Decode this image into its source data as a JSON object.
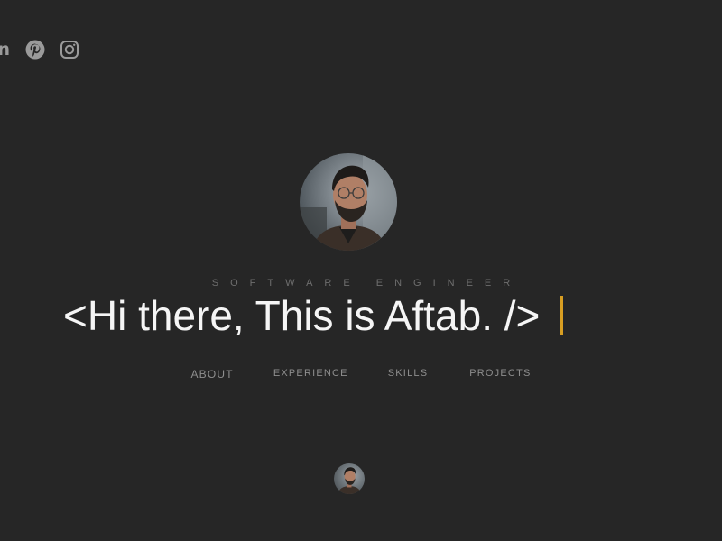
{
  "social": {
    "linkedin_label": "in",
    "icons": [
      "linkedin-icon",
      "pinterest-icon",
      "instagram-icon"
    ]
  },
  "hero": {
    "role": "SOFTWARE ENGINEER",
    "headline": "<Hi there, This is Aftab. />",
    "cursor_color": "#d89e22"
  },
  "nav": {
    "items": [
      "ABOUT",
      "EXPERIENCE",
      "SKILLS",
      "PROJECTS"
    ]
  },
  "colors": {
    "background": "#262626",
    "text": "#f5f5f5",
    "muted": "#8e8e8e",
    "accent": "#d89e22"
  }
}
